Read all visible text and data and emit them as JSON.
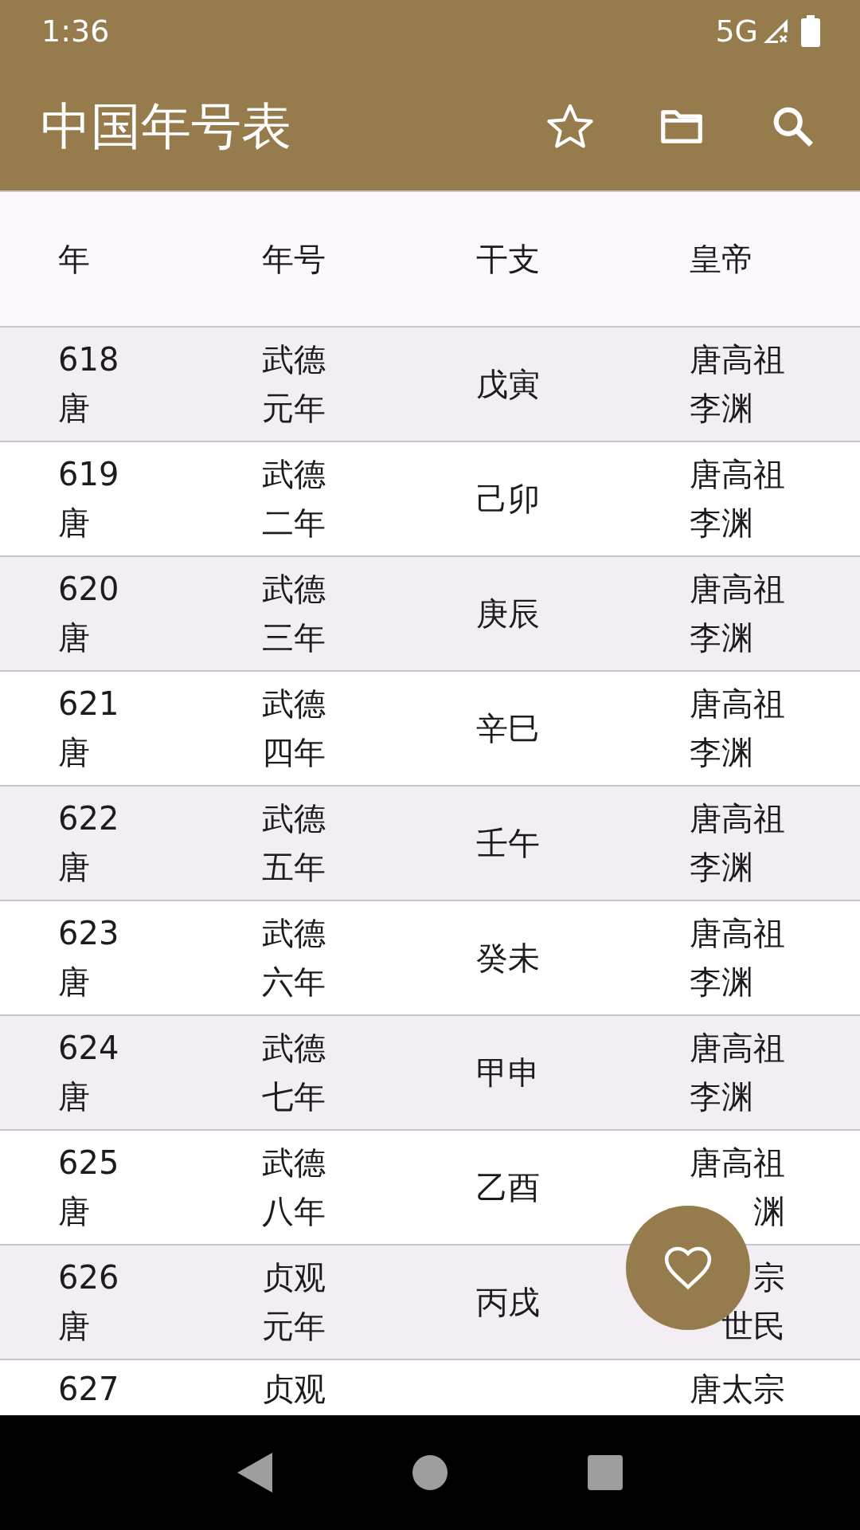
{
  "status_bar": {
    "time": "1:36",
    "network": "5G"
  },
  "app_bar": {
    "title": "中国年号表"
  },
  "table": {
    "columns": [
      "年",
      "年号",
      "干支",
      "皇帝"
    ],
    "rows": [
      {
        "year": "618",
        "dynasty": "唐",
        "era": [
          "武德",
          "元年"
        ],
        "ganzhi": "戊寅",
        "emperor": [
          "唐高祖",
          "李渊"
        ]
      },
      {
        "year": "619",
        "dynasty": "唐",
        "era": [
          "武德",
          "二年"
        ],
        "ganzhi": "己卯",
        "emperor": [
          "唐高祖",
          "李渊"
        ]
      },
      {
        "year": "620",
        "dynasty": "唐",
        "era": [
          "武德",
          "三年"
        ],
        "ganzhi": "庚辰",
        "emperor": [
          "唐高祖",
          "李渊"
        ]
      },
      {
        "year": "621",
        "dynasty": "唐",
        "era": [
          "武德",
          "四年"
        ],
        "ganzhi": "辛巳",
        "emperor": [
          "唐高祖",
          "李渊"
        ]
      },
      {
        "year": "622",
        "dynasty": "唐",
        "era": [
          "武德",
          "五年"
        ],
        "ganzhi": "壬午",
        "emperor": [
          "唐高祖",
          "李渊"
        ]
      },
      {
        "year": "623",
        "dynasty": "唐",
        "era": [
          "武德",
          "六年"
        ],
        "ganzhi": "癸未",
        "emperor": [
          "唐高祖",
          "李渊"
        ]
      },
      {
        "year": "624",
        "dynasty": "唐",
        "era": [
          "武德",
          "七年"
        ],
        "ganzhi": "甲申",
        "emperor": [
          "唐高祖",
          "李渊"
        ]
      },
      {
        "year": "625",
        "dynasty": "唐",
        "era": [
          "武德",
          "八年"
        ],
        "ganzhi": "乙酉",
        "emperor": [
          "唐高祖",
          "渊"
        ],
        "emperor_covered": true
      },
      {
        "year": "626",
        "dynasty": "唐",
        "era": [
          "贞观",
          "元年"
        ],
        "ganzhi": "丙戌",
        "emperor": [
          "宗",
          "世民"
        ],
        "emperor_covered": true
      },
      {
        "year": "627",
        "era": [
          "贞观"
        ],
        "emperor": [
          "唐太宗"
        ]
      }
    ]
  }
}
